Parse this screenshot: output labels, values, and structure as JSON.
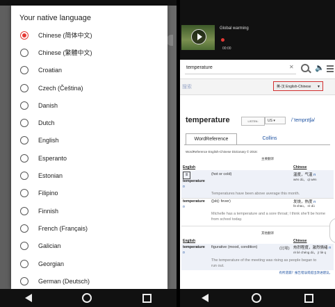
{
  "left_panel": {
    "dialog_title": "Your native language",
    "languages": [
      {
        "label": "Chinese (简体中文)",
        "selected": true
      },
      {
        "label": "Chinese (繁體中文)",
        "selected": false
      },
      {
        "label": "Croatian",
        "selected": false
      },
      {
        "label": "Czech (Čeština)",
        "selected": false
      },
      {
        "label": "Danish",
        "selected": false
      },
      {
        "label": "Dutch",
        "selected": false
      },
      {
        "label": "English",
        "selected": false
      },
      {
        "label": "Esperanto",
        "selected": false
      },
      {
        "label": "Estonian",
        "selected": false
      },
      {
        "label": "Filipino",
        "selected": false
      },
      {
        "label": "Finnish",
        "selected": false
      },
      {
        "label": "French (Français)",
        "selected": false
      },
      {
        "label": "Galician",
        "selected": false
      },
      {
        "label": "Georgian",
        "selected": false
      },
      {
        "label": "German (Deutsch)",
        "selected": false
      }
    ],
    "accent_color": "#e53935"
  },
  "right_panel": {
    "video": {
      "title": "Global warming",
      "time": "00:00"
    },
    "search_query": "temperature",
    "dict_search_placeholder": "搜索",
    "dictionary_select": "英-汉 English-Chinese",
    "headword": "temperature",
    "listen_label": "LISTEN:",
    "accent_option": "US",
    "pronunciation": "/ˈtemprɪtʃə/",
    "tabs": [
      "WordReference",
      "Collins"
    ],
    "active_tab": "WordReference",
    "dictionary_credit": "WordReference English-Chinese Dictionary © 2016:",
    "section_main": "主要翻译",
    "section_other": "其他翻译",
    "col_english": "English",
    "col_chinese": "Chinese",
    "entries": [
      {
        "word": "temperature",
        "pos": "n",
        "definition": "(hot or cold)",
        "chinese": "温度，气温",
        "chinese_pos": "n",
        "pinyin": "wēn dù， qì wēn",
        "example": "Temperatures have been above average this month."
      },
      {
        "word": "temperature",
        "pos": "n",
        "definition": "([sb]: fever)",
        "chinese": "发烧，热度",
        "chinese_pos": "n",
        "pinyin": "fā shāo， rè dù",
        "example": "Michelle has a temperature and a sore throat; I think she'll be home from school today."
      },
      {
        "word": "temperature",
        "pos": "n",
        "definition": "figurative (mood, condition)",
        "note": "(比喻)",
        "chinese": "热烈程度，激烈情绪",
        "chinese_pos": "n",
        "pinyin": "rè liè chéng dù， jī liè q",
        "example": "The temperature of the meeting was rising as people began to run out."
      }
    ],
    "suggestion_link": "有所遗漏？报告错误或提出改进建议。"
  }
}
